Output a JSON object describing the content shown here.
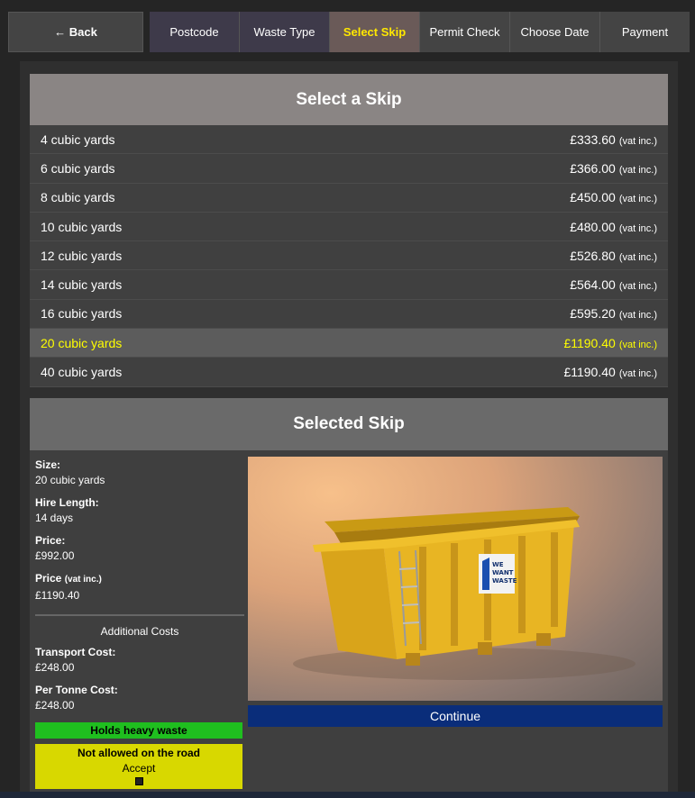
{
  "nav": {
    "back_label": "← Back",
    "steps": [
      {
        "label": "Postcode",
        "state": "done"
      },
      {
        "label": "Waste Type",
        "state": "done"
      },
      {
        "label": "Select Skip",
        "state": "active"
      },
      {
        "label": "Permit Check",
        "state": "pending"
      },
      {
        "label": "Choose Date",
        "state": "pending"
      },
      {
        "label": "Payment",
        "state": "pending"
      }
    ]
  },
  "skip_panel": {
    "title": "Select a Skip",
    "vat_note": "(vat inc.)",
    "items": [
      {
        "size": "4 cubic yards",
        "price": "£333.60",
        "selected": false
      },
      {
        "size": "6 cubic yards",
        "price": "£366.00",
        "selected": false
      },
      {
        "size": "8 cubic yards",
        "price": "£450.00",
        "selected": false
      },
      {
        "size": "10 cubic yards",
        "price": "£480.00",
        "selected": false
      },
      {
        "size": "12 cubic yards",
        "price": "£526.80",
        "selected": false
      },
      {
        "size": "14 cubic yards",
        "price": "£564.00",
        "selected": false
      },
      {
        "size": "16 cubic yards",
        "price": "£595.20",
        "selected": false
      },
      {
        "size": "20 cubic yards",
        "price": "£1190.40",
        "selected": true
      },
      {
        "size": "40 cubic yards",
        "price": "£1190.40",
        "selected": false
      }
    ]
  },
  "selected": {
    "title": "Selected Skip",
    "size_label": "Size:",
    "size_value": "20 cubic yards",
    "hire_label": "Hire Length:",
    "hire_value": "14 days",
    "price_label": "Price:",
    "price_value": "£992.00",
    "price_vat_label": "Price",
    "price_vat_note": "(vat inc.)",
    "price_vat_value": "£1190.40",
    "additional_heading": "Additional Costs",
    "transport_label": "Transport Cost:",
    "transport_value": "£248.00",
    "tonne_label": "Per Tonne Cost:",
    "tonne_value": "£248.00",
    "heavy_badge": "Holds heavy waste",
    "road_warning": "Not allowed on the road",
    "accept_label": "Accept",
    "continue_label": "Continue",
    "image_logo": "WE WANT WASTE"
  },
  "colors": {
    "accent_yellow": "#ffe800",
    "heavy_green": "#1fbf1f",
    "road_yellow": "#d8d800",
    "continue_blue": "#0a2d7a"
  }
}
